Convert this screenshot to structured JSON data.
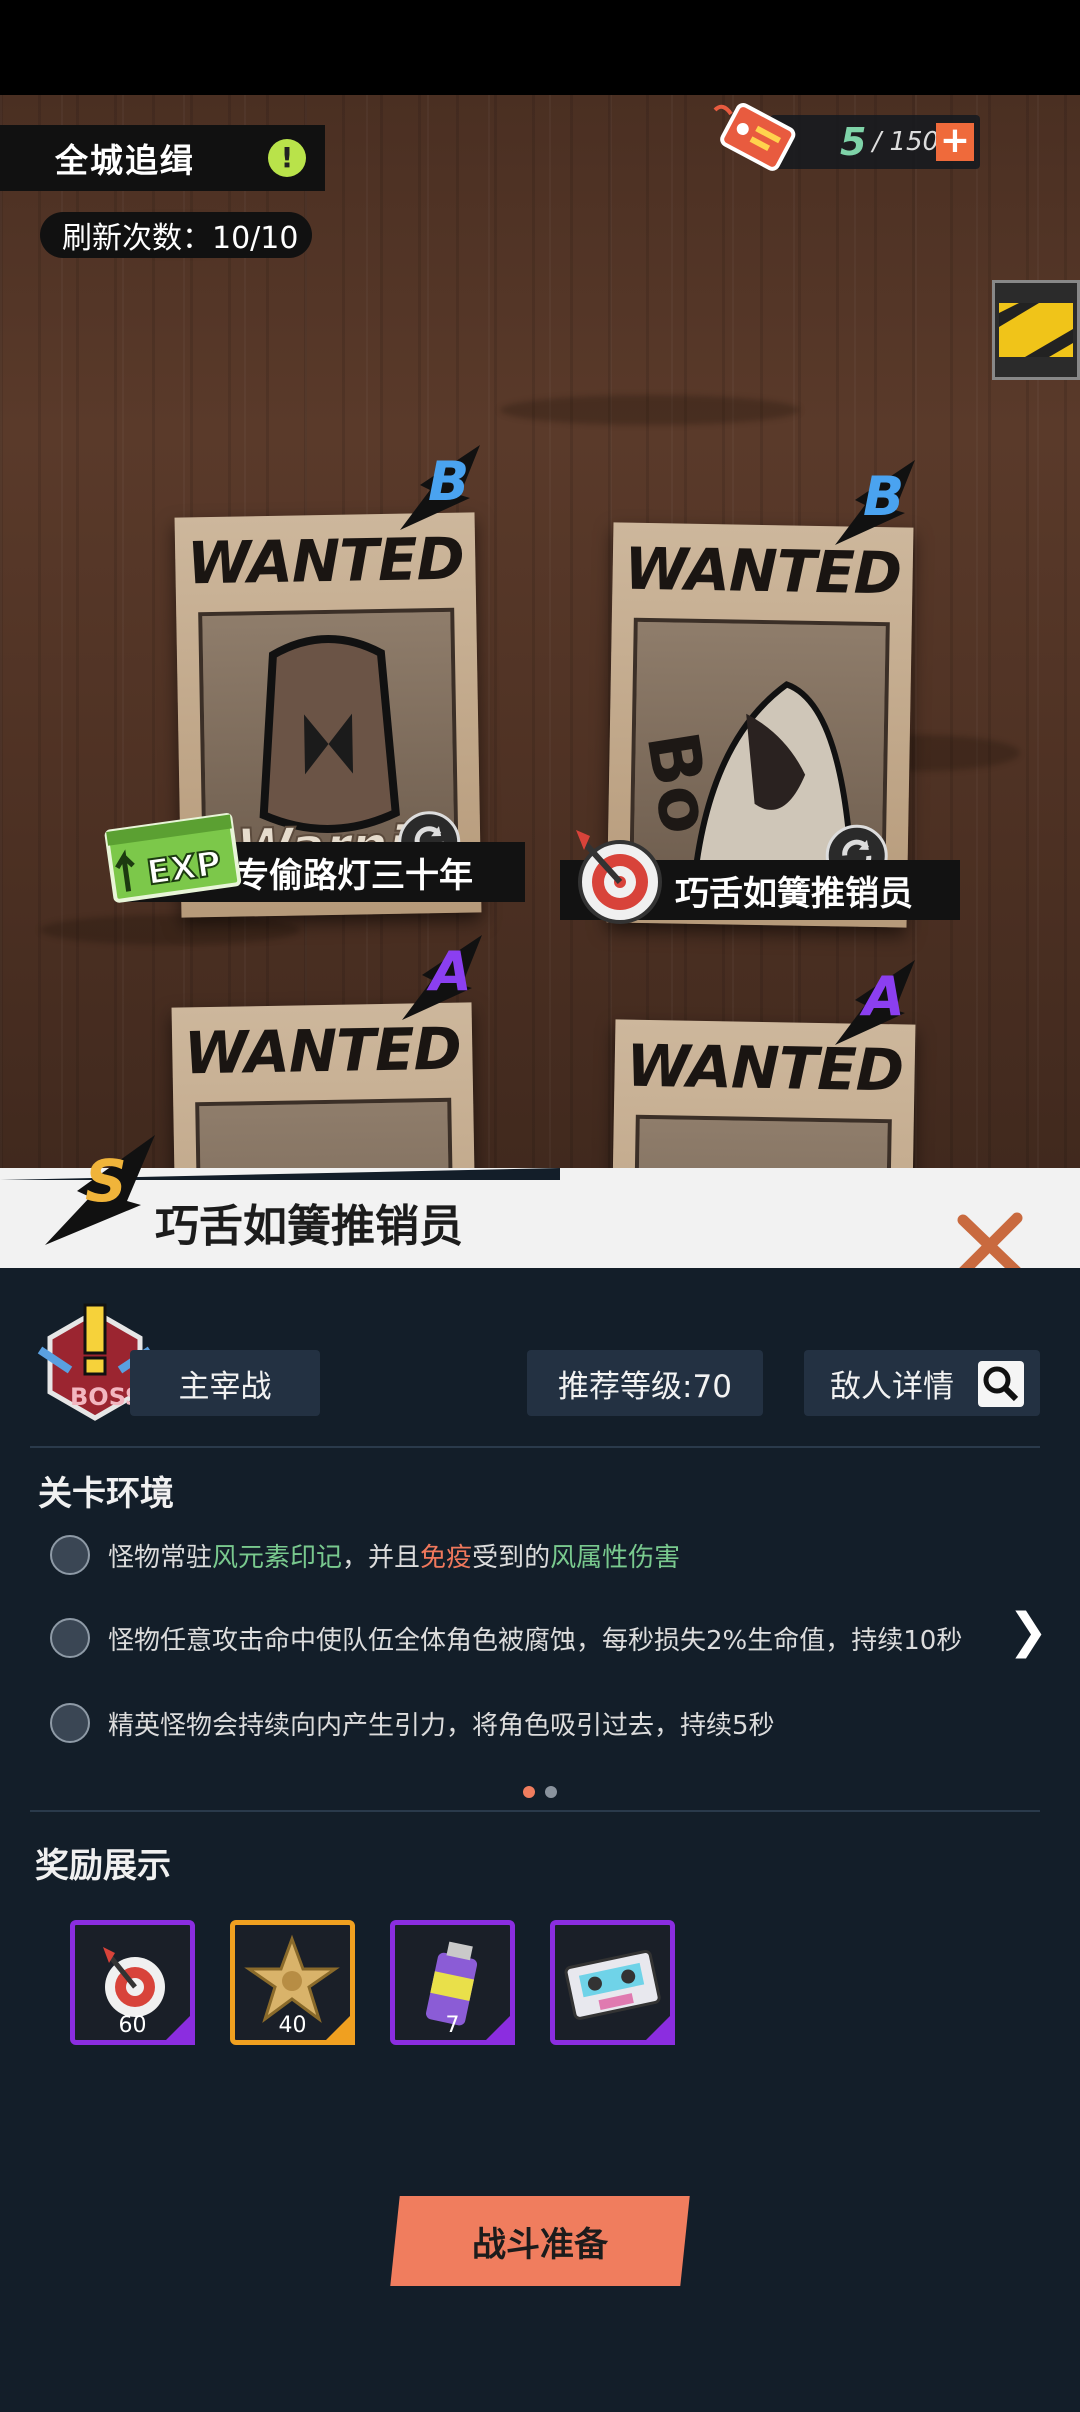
{
  "top": {
    "title": "全城追缉",
    "hint_icon_text": "!",
    "refresh_text": "刷新次数：10/10",
    "stamina_current": "5",
    "stamina_max": "/ 150",
    "stamina_add": "+"
  },
  "cards": [
    {
      "header": "WANTED",
      "rank": "B",
      "name": "专偷路灯三十年",
      "reward_icon": "exp-card-icon",
      "reward_label": "EXP"
    },
    {
      "header": "WANTED",
      "rank": "B",
      "name": "巧舌如簧推销员",
      "reward_icon": "dart-icon"
    },
    {
      "header": "WANTED",
      "rank": "A"
    },
    {
      "header": "WANTED",
      "rank": "A"
    }
  ],
  "detail": {
    "rank": "S",
    "name": "巧舌如簧推销员",
    "boss_tag": "主宰战",
    "recommend": "推荐等级:70",
    "enemy_detail": "敌人详情",
    "env_title": "关卡环境",
    "env": [
      {
        "parts": [
          "怪物常驻",
          "风元素印记",
          "，并且",
          "免疫",
          "受到的",
          "风属性伤害"
        ]
      },
      {
        "text": "怪物任意攻击命中使队伍全体角色被腐蚀，每秒损失2%生命值，持续10秒"
      },
      {
        "text": "精英怪物会持续向内产生引力，将角色吸引过去，持续5秒"
      }
    ],
    "next_arrow": "❯",
    "rewards_title": "奖励展示",
    "rewards": [
      {
        "icon": "dart-icon",
        "count": "60",
        "rarity_color": "#8b2de0"
      },
      {
        "icon": "sheriff-star-icon",
        "count": "40",
        "rarity_color": "#f0a020"
      },
      {
        "icon": "spray-can-icon",
        "count": "7",
        "rarity_color": "#8b2de0"
      },
      {
        "icon": "cassette-icon",
        "count": "",
        "rarity_color": "#8b2de0"
      }
    ],
    "battle_button": "战斗准备"
  },
  "colors": {
    "accent_orange": "#f07d5e",
    "panel_bg": "#131e29",
    "rank_b": "#4aa3f0",
    "rank_a": "#8b3ff0",
    "rank_s": "#f0b43a"
  }
}
